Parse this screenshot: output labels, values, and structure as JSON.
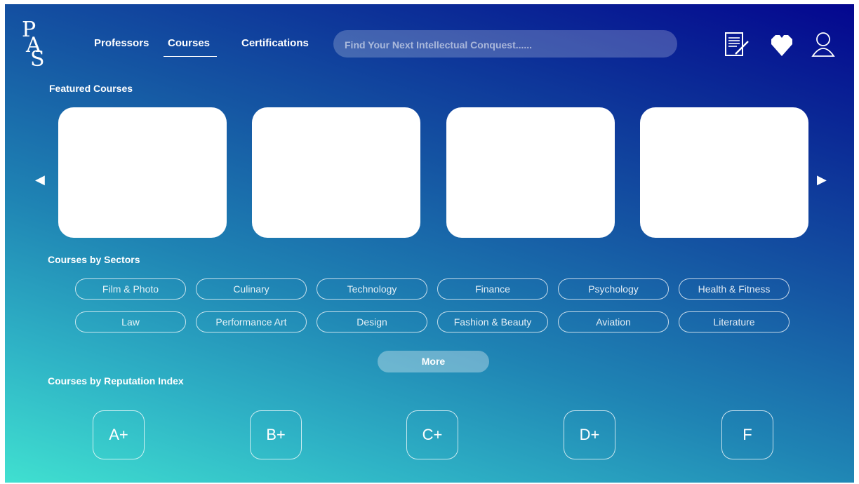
{
  "brand": {
    "logo_letters": [
      "P",
      "A",
      "S"
    ]
  },
  "nav": {
    "professors": "Professors",
    "courses": "Courses",
    "certifications": "Certifications"
  },
  "search": {
    "placeholder": "Find Your Next Intellectual Conquest......",
    "value": ""
  },
  "header_icons": [
    "notepad-pencil-icon",
    "heart-icon",
    "user-profile-icon"
  ],
  "featured": {
    "title": "Featured Courses",
    "prev_label": "◀",
    "next_label": "▶",
    "card_count": 4
  },
  "sectors": {
    "title": "Courses by Sectors",
    "row1": [
      "Film & Photo",
      "Culinary",
      "Technology",
      "Finance",
      "Psychology",
      "Health & Fitness"
    ],
    "row2": [
      "Law",
      "Performance Art",
      "Design",
      "Fashion & Beauty",
      "Aviation",
      "Literature"
    ],
    "more_label": "More"
  },
  "reputation": {
    "title": "Courses by Reputation Index",
    "grades": [
      "A+",
      "B+",
      "C+",
      "D+",
      "F"
    ]
  },
  "colors": {
    "gradient_start": "#40e0d0",
    "gradient_end": "#04068f",
    "card_fill": "#ffffff"
  }
}
